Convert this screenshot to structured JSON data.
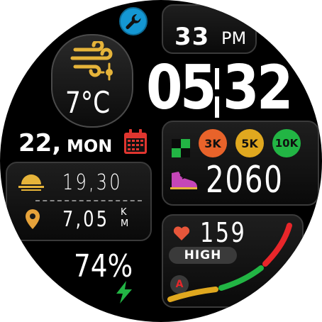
{
  "status": {
    "settings_icon": "wrench-icon"
  },
  "seconds": {
    "value": "33",
    "ampm": "PM"
  },
  "time": {
    "hours": "05",
    "minutes": "32"
  },
  "weather": {
    "icon": "windy-sun-icon",
    "temperature": "7°C"
  },
  "date": {
    "day": "22,",
    "weekday": "MON",
    "icon": "calendar-icon"
  },
  "sun": {
    "icon": "sunrise-icon",
    "value": "19,30"
  },
  "distance": {
    "icon": "location-pin-icon",
    "value": "7,05",
    "unit_top": "K",
    "unit_bottom": "M"
  },
  "steps": {
    "goal_icon": "checkered-flag-icon",
    "badges": [
      {
        "label": "3K",
        "color": "#e8632a"
      },
      {
        "label": "5K",
        "color": "#e0a81f"
      },
      {
        "label": "10K",
        "color": "#22b544"
      }
    ],
    "icon": "shoe-icon",
    "count": "2060"
  },
  "heart": {
    "icon": "heart-icon",
    "bpm": "159",
    "zone": "HIGH",
    "zone_badge_letter": "A"
  },
  "battery": {
    "percent": "74%",
    "icon": "lightning-icon"
  },
  "colors": {
    "orange": "#e8632a",
    "yellow": "#e0a81f",
    "green": "#22b544",
    "red": "#e8262a",
    "gold": "#e6b43a"
  }
}
